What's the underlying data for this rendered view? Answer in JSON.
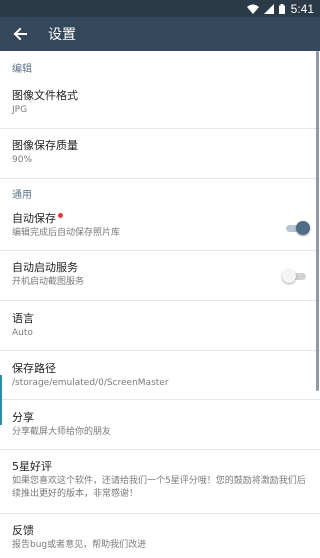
{
  "status_bar": {
    "time": "5:41",
    "icons": [
      "wifi-icon",
      "signal-icon",
      "battery-icon"
    ]
  },
  "toolbar": {
    "title": "设置",
    "back_icon": "arrow-back-icon"
  },
  "sections": {
    "edit": "编辑",
    "general": "通用"
  },
  "items": {
    "image_format": {
      "title": "图像文件格式",
      "subtitle": "JPG"
    },
    "image_quality": {
      "title": "图像保存质量",
      "subtitle": "90%"
    },
    "auto_save": {
      "title": "自动保存",
      "subtitle": "编辑完成后自动保存照片库",
      "enabled": true,
      "has_badge": true
    },
    "auto_start": {
      "title": "自动启动服务",
      "subtitle": "开机启动截图服务",
      "enabled": false
    },
    "language": {
      "title": "语言",
      "subtitle": "Auto"
    },
    "save_path": {
      "title": "保存路径",
      "subtitle": "/storage/emulated/0/ScreenMaster"
    },
    "share": {
      "title": "分享",
      "subtitle": "分享截屏大师给你的朋友"
    },
    "rate": {
      "title": "5星好评",
      "subtitle": "如果您喜欢这个软件，还请给我们一个5星评分哦！您的鼓励将激励我们后续推出更好的版本，非常感谢！"
    },
    "feedback": {
      "title": "反馈",
      "subtitle": "报告bug或者意见，帮助我们改进"
    }
  },
  "colors": {
    "status_bar": "#2b3a47",
    "toolbar": "#35475a",
    "section_header": "#5b7489",
    "switch_on": "#4f6d86",
    "badge": "#e53935"
  }
}
